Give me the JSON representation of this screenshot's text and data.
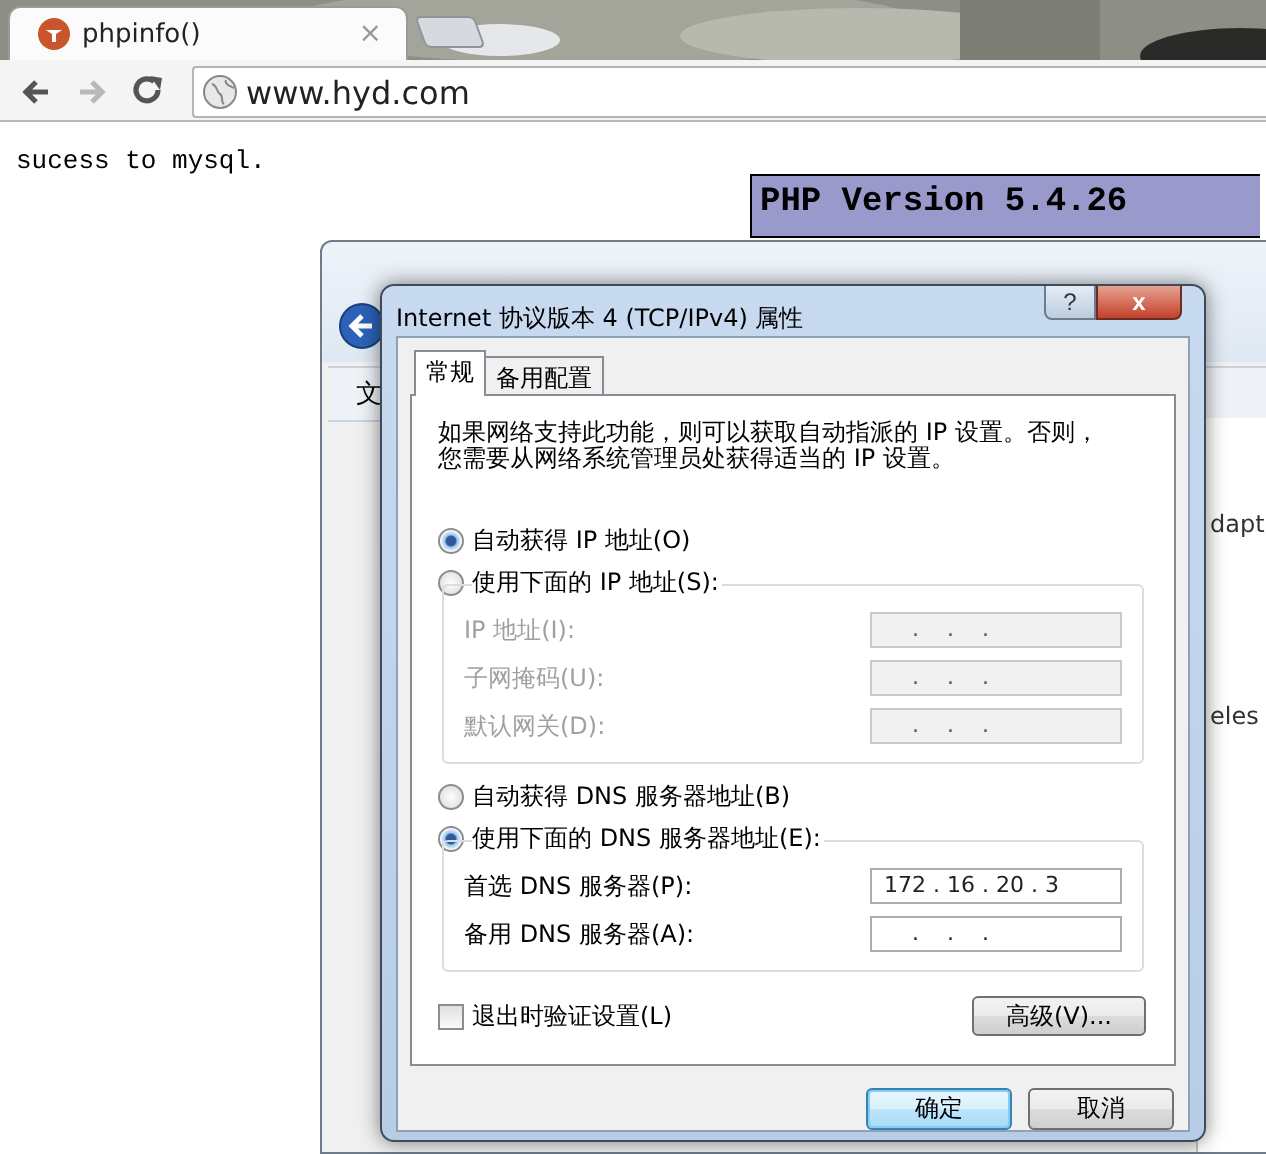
{
  "browser": {
    "tabs": [
      {
        "title": "phpinfo()",
        "selected": true
      }
    ],
    "close_tab": "×",
    "back": {
      "disabled": false
    },
    "forward": {
      "disabled": true
    },
    "url": "www.hyd.com"
  },
  "page": {
    "message": "sucess to mysql.",
    "php_header": "PHP Version 5.4.26"
  },
  "background_window": {
    "menu_text": "文",
    "side_texts": [
      "dapt",
      "eles"
    ]
  },
  "dialog": {
    "title": "Internet 协议版本 4 (TCP/IPv4) 属性",
    "help": "?",
    "close": "x",
    "tabs": [
      {
        "label": "常规",
        "selected": true
      },
      {
        "label": "备用配置",
        "selected": false
      }
    ],
    "description": [
      "如果网络支持此功能，则可以获取自动指派的 IP 设置。否则，",
      "您需要从网络系统管理员处获得适当的 IP 设置。"
    ],
    "groups": [
      {
        "options": [
          {
            "label": "自动获得 IP 地址(O)",
            "selected": true
          },
          {
            "label": "使用下面的 IP 地址(S):",
            "selected": false
          }
        ],
        "fields": [
          {
            "label": "IP 地址(I):",
            "value": "    .    .    .",
            "disabled": true
          },
          {
            "label": "子网掩码(U):",
            "value": "    .    .    .",
            "disabled": true
          },
          {
            "label": "默认网关(D):",
            "value": "    .    .    .",
            "disabled": true
          }
        ]
      },
      {
        "options": [
          {
            "label": "自动获得 DNS 服务器地址(B)",
            "selected": false
          },
          {
            "label": "使用下面的 DNS 服务器地址(E):",
            "selected": true
          }
        ],
        "fields": [
          {
            "label": "首选 DNS 服务器(P):",
            "value": "172 . 16 . 20 . 3",
            "disabled": false
          },
          {
            "label": "备用 DNS 服务器(A):",
            "value": "    .    .    .",
            "disabled": false
          }
        ]
      }
    ],
    "validate": {
      "label": "退出时验证设置(L)",
      "checked": false
    },
    "advanced": "高级(V)...",
    "buttons": [
      {
        "label": "确定",
        "default": true
      },
      {
        "label": "取消",
        "default": false
      }
    ]
  }
}
